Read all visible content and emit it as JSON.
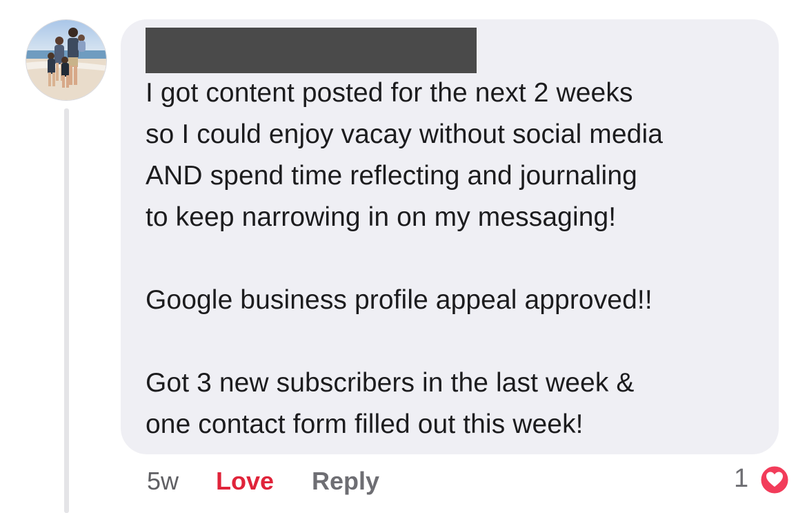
{
  "comment": {
    "author_redacted": true,
    "text": "I got content posted for the next 2 weeks\nso I could enjoy vacay without social media\nAND spend time reflecting and journaling\nto keep narrowing in on my messaging!\n\nGoogle business profile appeal approved!!\n\nGot 3 new subscribers in the last week &\none contact form filled out this week!",
    "time": "5w",
    "love_label": "Love",
    "reply_label": "Reply",
    "reaction_count": "1",
    "reaction_icon": "heart-icon"
  },
  "colors": {
    "bubble": "#efeff4",
    "love": "#e0243a",
    "reaction_heart_bg": "#f23c5a"
  }
}
